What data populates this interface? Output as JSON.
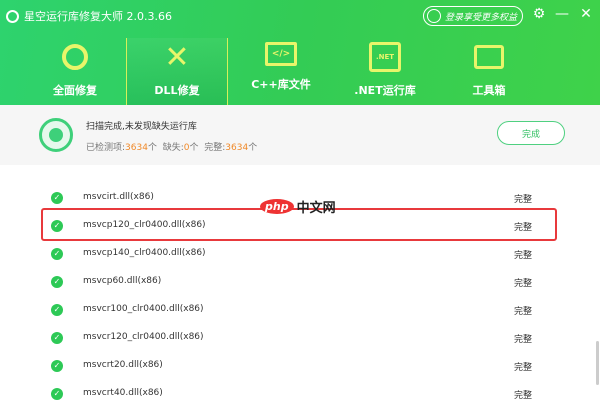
{
  "app": {
    "title": "星空运行库修复大师 2.0.3.66",
    "login": "登录享受更多权益"
  },
  "tabs": [
    {
      "label": "全面修复"
    },
    {
      "label": "DLL修复",
      "active": true
    },
    {
      "label": "C++库文件"
    },
    {
      "label": ".NET运行库"
    },
    {
      "label": "工具箱"
    }
  ],
  "summary": {
    "message": "扫描完成,未发现缺失运行库",
    "checked_label": "已检测项:",
    "checked": "3634",
    "unit": "个",
    "missing_label": "缺失:",
    "missing": "0",
    "complete_label": "完整:",
    "complete": "3634",
    "done_button": "完成"
  },
  "rows": [
    {
      "name": "msvcirt.dll(x86)",
      "status": "完整"
    },
    {
      "name": "msvcp120_clr0400.dll(x86)",
      "status": "完整"
    },
    {
      "name": "msvcp140_clr0400.dll(x86)",
      "status": "完整"
    },
    {
      "name": "msvcp60.dll(x86)",
      "status": "完整"
    },
    {
      "name": "msvcr100_clr0400.dll(x86)",
      "status": "完整"
    },
    {
      "name": "msvcr120_clr0400.dll(x86)",
      "status": "完整"
    },
    {
      "name": "msvcrt20.dll(x86)",
      "status": "完整"
    },
    {
      "name": "msvcrt40.dll(x86)",
      "status": "完整"
    }
  ],
  "watermark": {
    "logo": "php",
    "text": "中文网"
  },
  "icons": {
    "net": ".NET",
    "code": "</>"
  }
}
